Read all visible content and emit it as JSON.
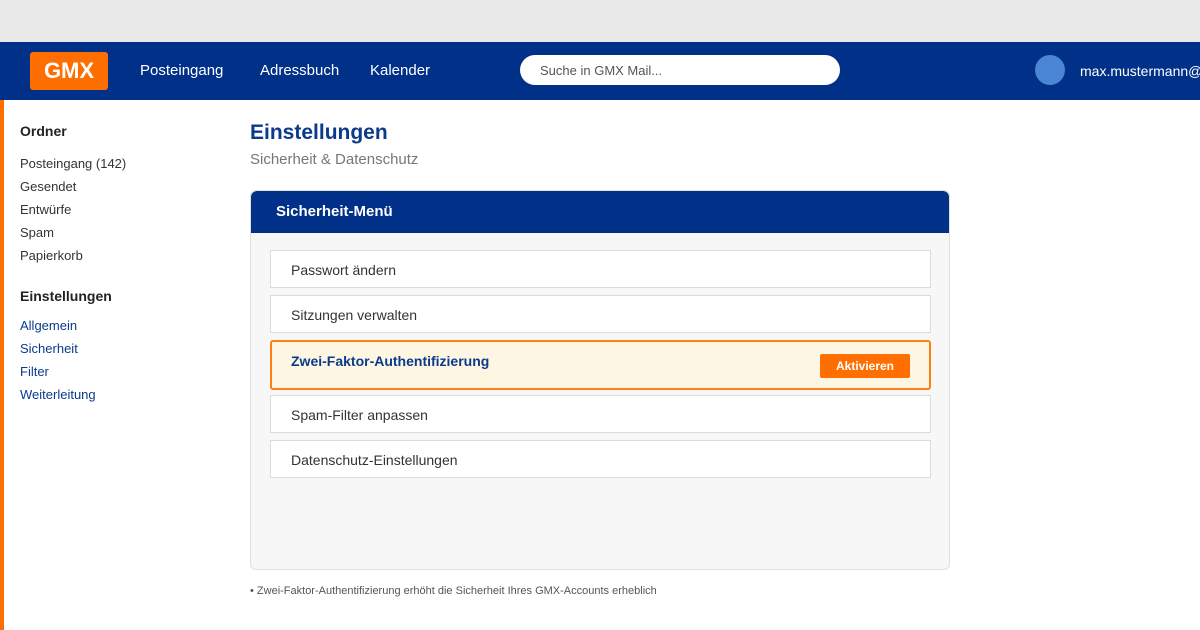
{
  "header": {
    "logo": "GMX",
    "nav": [
      "Posteingang",
      "Adressbuch",
      "Kalender"
    ],
    "search_placeholder": "Suche in GMX Mail...",
    "username": "max.mustermann@"
  },
  "sidebar": {
    "folders_heading": "Ordner",
    "folders": [
      "Posteingang (142)",
      "Gesendet",
      "Entwürfe",
      "Spam",
      "Papierkorb"
    ],
    "settings_heading": "Einstellungen",
    "settings_links": [
      "Allgemein",
      "Sicherheit",
      "Filter",
      "Weiterleitung"
    ]
  },
  "main": {
    "title": "Einstellungen",
    "subtitle": "Sicherheit & Datenschutz",
    "panel_title": "Sicherheit-Menü",
    "items": [
      "Passwort ändern",
      "Sitzungen verwalten",
      "Zwei-Faktor-Authentifizierung",
      "Spam-Filter anpassen",
      "Datenschutz-Einstellungen"
    ],
    "activate_label": "Aktivieren",
    "footnote": "• Zwei-Faktor-Authentifizierung erhöht die Sicherheit Ihres GMX-Accounts erheblich"
  },
  "colors": {
    "brand_blue": "#003087",
    "brand_orange": "#FF6E00",
    "highlight_bg": "#FDF6E2"
  }
}
